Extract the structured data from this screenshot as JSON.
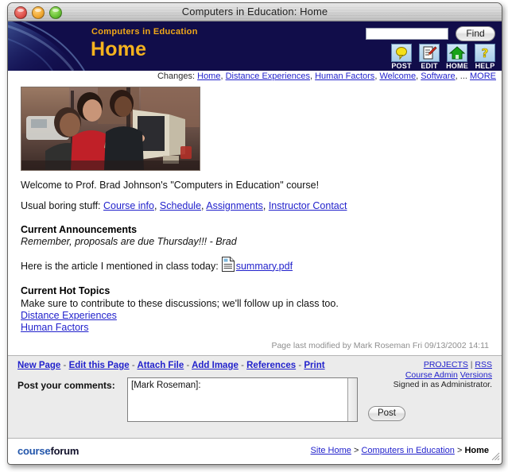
{
  "window": {
    "title": "Computers in Education: Home",
    "buttons": [
      "close",
      "minimize",
      "maximize"
    ]
  },
  "header": {
    "brand": "Computers in Education",
    "page_title": "Home",
    "search": {
      "value": "",
      "placeholder": ""
    },
    "find_label": "Find",
    "tools": [
      {
        "label": "POST",
        "icon": "speech-bubble-icon"
      },
      {
        "label": "EDIT",
        "icon": "pencil-document-icon"
      },
      {
        "label": "HOME",
        "icon": "house-icon"
      },
      {
        "label": "HELP",
        "icon": "question-mark-icon"
      }
    ],
    "colors": {
      "navy": "#110d4a",
      "gold": "#f4b21e",
      "icon_tile": "#a9cde9"
    }
  },
  "changes": {
    "label": "Changes:",
    "items": [
      "Home",
      "Distance Experiences",
      "Human Factors",
      "Welcome",
      "Software"
    ],
    "ellipsis": "...",
    "more": "MORE"
  },
  "content": {
    "photo_alt": "Three people looking at a computer monitor",
    "welcome": "Welcome to Prof. Brad Johnson's \"Computers in Education\" course!",
    "links_intro": "Usual boring stuff:",
    "links": [
      "Course info",
      "Schedule",
      "Assignments",
      "Instructor Contact"
    ],
    "announcements_heading": "Current Announcements",
    "announcement_text": "Remember, proposals are due Thursday!!! - Brad",
    "attachment_intro": "Here is the article I mentioned in class today:",
    "attachment_name": "summary.pdf",
    "hot_topics_heading": "Current Hot Topics",
    "hot_topics_text": "Make sure to contribute to these discussions; we'll follow up in class too.",
    "hot_topics": [
      "Distance Experiences",
      "Human Factors"
    ],
    "last_modified": "Page last modified by Mark Roseman Fri 09/13/2002 14:11"
  },
  "actions": {
    "links": [
      "New Page",
      "Edit this Page",
      "Attach File",
      "Add Image",
      "References",
      "Print"
    ],
    "separator": "-",
    "right": {
      "projects": "PROJECTS",
      "pipe": "|",
      "rss": "RSS",
      "course_admin": "Course Admin",
      "versions": "Versions",
      "signed_in": "Signed in as Administrator."
    },
    "comment_label": "Post your comments:",
    "comment_value": "[Mark Roseman]:",
    "post_label": "Post"
  },
  "footer": {
    "logo_part1": "course",
    "logo_part2": "forum",
    "breadcrumb": [
      {
        "text": "Site Home",
        "link": true
      },
      {
        "text": ">",
        "link": false
      },
      {
        "text": "Computers in Education",
        "link": true
      },
      {
        "text": ">",
        "link": false
      },
      {
        "text": "Home",
        "link": false,
        "current": true
      }
    ]
  }
}
